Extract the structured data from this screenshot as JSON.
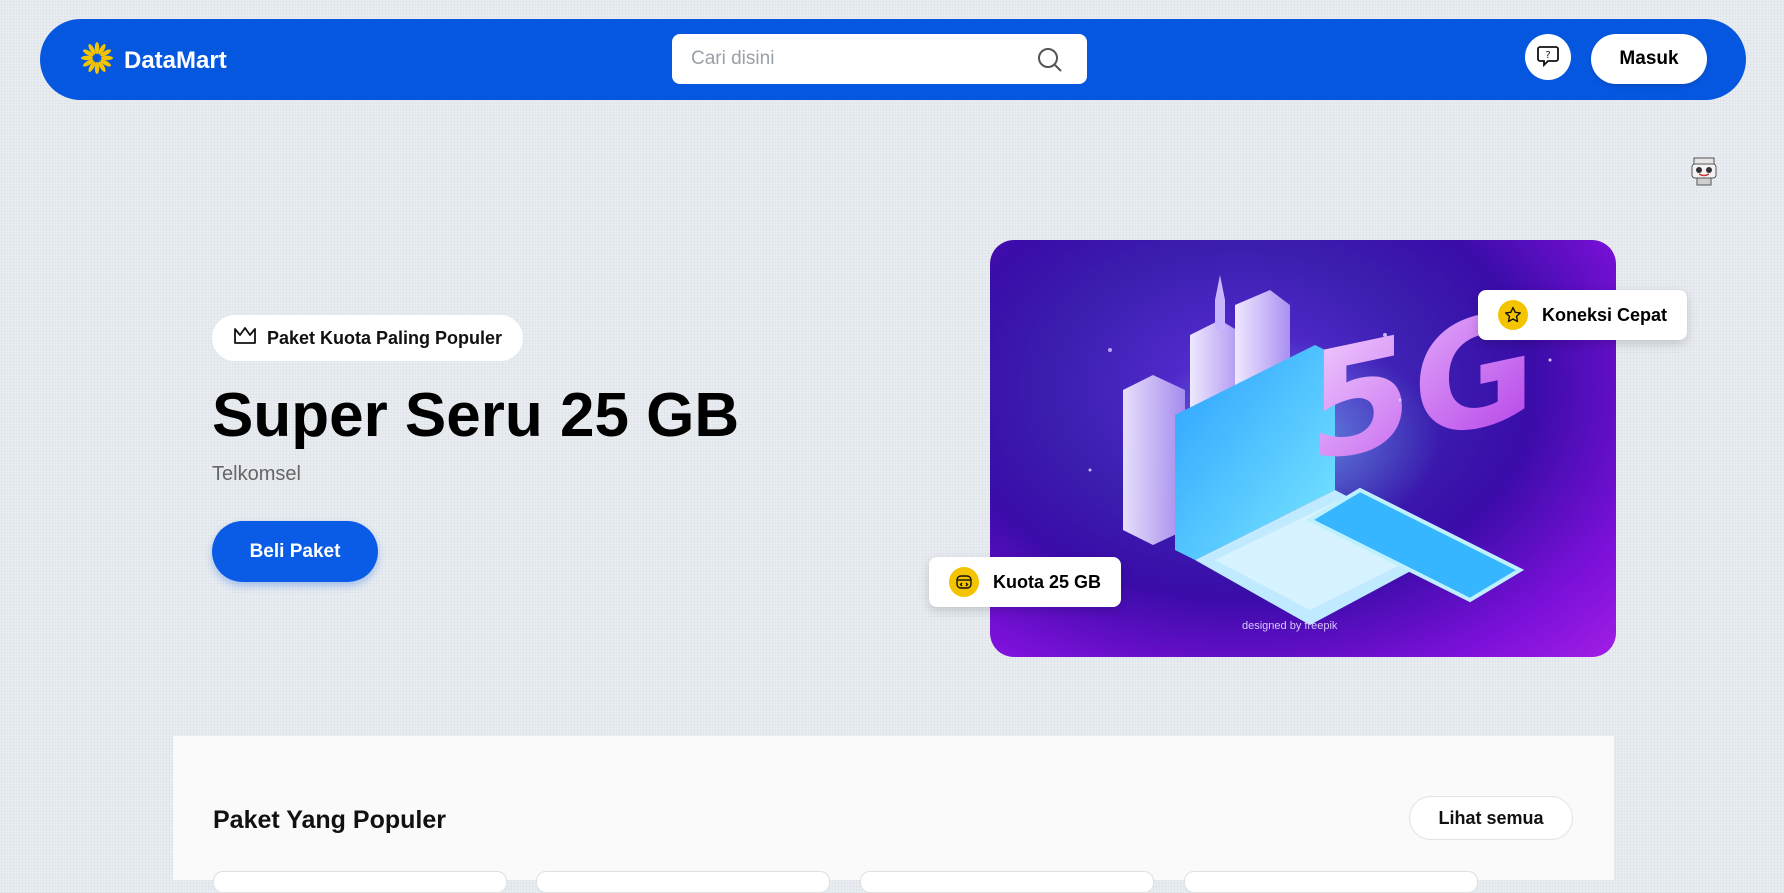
{
  "header": {
    "brand": "DataMart",
    "search_placeholder": "Cari disini",
    "login_label": "Masuk"
  },
  "hero": {
    "badge": "Paket Kuota Paling Populer",
    "title": "Super Seru 25 GB",
    "provider": "Telkomsel",
    "buy_label": "Beli Paket",
    "image_credit": "designed by freepik",
    "image_text": "5G",
    "feature_speed": "Koneksi Cepat",
    "feature_quota": "Kuota 25 GB"
  },
  "popular": {
    "title": "Paket Yang Populer",
    "see_all_label": "Lihat semua"
  },
  "colors": {
    "primary": "#0657e0",
    "accent": "#f5c400",
    "hero_bg": "#3a0ca8"
  }
}
